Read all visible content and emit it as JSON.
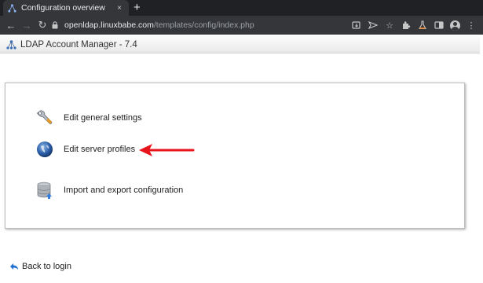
{
  "browser": {
    "tab_title": "Configuration overview",
    "tab_close": "×",
    "new_tab": "+",
    "url_host": "openldap.linuxbabe.com",
    "url_path": "/templates/config/index.php",
    "icons": [
      "back-icon",
      "forward-icon",
      "reload-icon",
      "lock-icon",
      "install-icon",
      "share-icon",
      "star-icon",
      "extensions-icon",
      "lab-icon",
      "sidepanel-icon",
      "profile-icon",
      "menu-icon"
    ]
  },
  "app": {
    "title": "LDAP Account Manager - 7.4"
  },
  "menu": {
    "items": [
      {
        "label": "Edit general settings",
        "icon": "wrench-icon"
      },
      {
        "label": "Edit server profiles",
        "icon": "globe-icon"
      },
      {
        "label": "Import and export configuration",
        "icon": "database-import-icon"
      }
    ]
  },
  "footer": {
    "back_label": "Back to login",
    "back_icon": "back-arrow-icon"
  },
  "colors": {
    "annotation_arrow": "#e8141b",
    "browser_dark": "#202124",
    "browser_toolbar": "#35363a"
  }
}
